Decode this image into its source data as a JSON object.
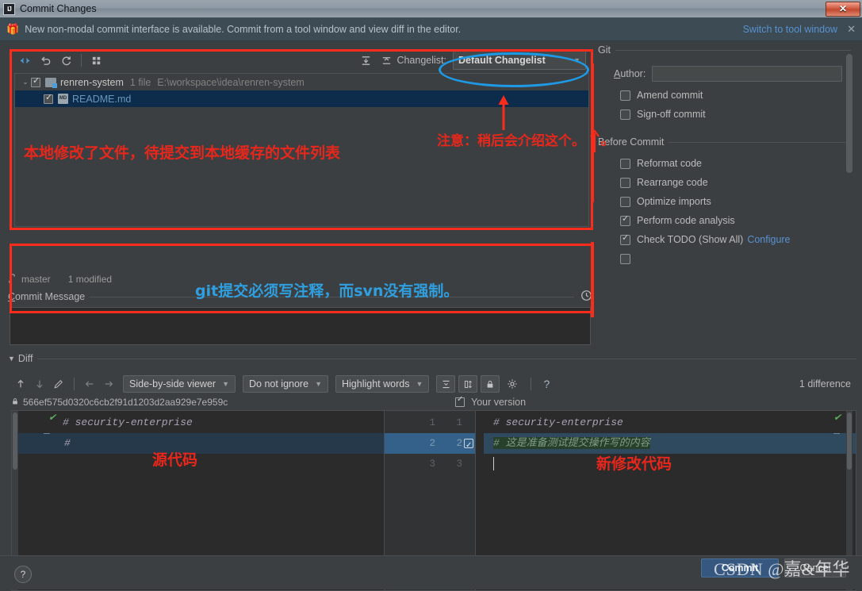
{
  "window": {
    "title": "Commit Changes",
    "logo_text": "IJ",
    "close_label": "✕"
  },
  "notice": {
    "gift_icon": "gift-icon",
    "text": "New non-modal commit interface is available. Commit from a tool window and view diff in the editor.",
    "link": "Switch to tool window",
    "close": "✕"
  },
  "changes": {
    "toolbar": {
      "collapse_icon": "collapse-all-icon",
      "revert_icon": "rollback-icon",
      "refresh_icon": "refresh-icon",
      "group_icon": "group-by-icon",
      "expand_icon": "expand-all-icon",
      "collapse2_icon": "collapse-selected-icon"
    },
    "changelist_label": "Changelist:",
    "changelist_value": "Default Changelist",
    "changelist_arrow": "▼",
    "tree": [
      {
        "type": "folder",
        "twisty": "⌄",
        "checked": true,
        "name": "renren-system",
        "count": "1 file",
        "path": "E:\\workspace\\idea\\renren-system"
      },
      {
        "type": "file",
        "checked": true,
        "icon_label": "MD",
        "name": "README.md",
        "count": "",
        "path": ""
      }
    ]
  },
  "branch_bar": {
    "icon": "branch-icon",
    "branch": "master",
    "modified": "1 modified"
  },
  "options": {
    "git_group": "Git",
    "author_label": "Author:",
    "author_value": "",
    "git_checks": [
      {
        "label": "Amend commit",
        "checked": false
      },
      {
        "label": "Sign-off commit",
        "checked": false
      }
    ],
    "before_group": "Before Commit",
    "before_checks": [
      {
        "label": "Reformat code",
        "checked": false,
        "link": ""
      },
      {
        "label": "Rearrange code",
        "checked": false,
        "link": ""
      },
      {
        "label": "Optimize imports",
        "checked": false,
        "link": ""
      },
      {
        "label": "Perform code analysis",
        "checked": true,
        "link": ""
      },
      {
        "label": "Check TODO (Show All)",
        "checked": true,
        "link": "Configure"
      }
    ]
  },
  "commit_message": {
    "label": "Commit Message",
    "clock_icon": "history-clock-icon",
    "value": ""
  },
  "diff": {
    "section_label": "Diff",
    "section_arrow": "▼",
    "prev_icon": "previous-difference-icon",
    "next_icon": "next-difference-icon",
    "edit_icon": "edit-source-icon",
    "left_icon": "accept-left-icon",
    "right_icon": "accept-right-icon",
    "viewer_mode": "Side-by-side viewer",
    "ignore_mode": "Do not ignore",
    "highlight_mode": "Highlight words",
    "collapse_icon": "collapse-unchanged-icon",
    "whitespace_icon": "show-whitespace-icon",
    "readonly_icon": "lock-icon",
    "settings_icon": "gear-icon",
    "help_icon": "?",
    "difference_count": "1 difference",
    "revision_lock_icon": "lock-icon",
    "revision_hash": "566ef575d0320c6cb2f91d1203d2aa929e7e959c",
    "your_version_label": "Your version",
    "left_lines": [
      {
        "num": "1",
        "text": "# security-enterprise",
        "state": "normal"
      },
      {
        "num": "2",
        "text": "#",
        "state": "changed"
      },
      {
        "num": "3",
        "text": "",
        "state": "normal"
      }
    ],
    "right_lines": [
      {
        "num": "1",
        "text": "# security-enterprise",
        "state": "normal"
      },
      {
        "num": "2",
        "text": "# 这是准备测试提交操作写的内容",
        "state": "changed"
      },
      {
        "num": "3",
        "text": "",
        "state": "caret"
      }
    ],
    "gutter_rows": [
      {
        "left": "1",
        "right": "1",
        "checkbox": false
      },
      {
        "left": "2",
        "right": "2",
        "checkbox": true
      },
      {
        "left": "3",
        "right": "3",
        "checkbox": false
      }
    ]
  },
  "footer": {
    "help_label": "?",
    "commit_label": "Commit",
    "cancel_label": "Cancel"
  },
  "annotations": {
    "files_note": "本地修改了文件，待提交到本地缓存的文件列表",
    "changelist_note": "注意：稍后会介绍这个。",
    "message_note": "git提交必须写注释，而svn没有强制。",
    "left_code_note": "源代码",
    "right_code_note": "新修改代码"
  },
  "watermark": {
    "brand": "CSDN",
    "author": "@嘉&年华"
  },
  "colors": {
    "accent_blue": "#365880",
    "link_blue": "#5892d1",
    "annotation_red": "#e8271c",
    "annotation_circle_blue": "#1e9ae5",
    "inserted_green": "#27402c"
  }
}
